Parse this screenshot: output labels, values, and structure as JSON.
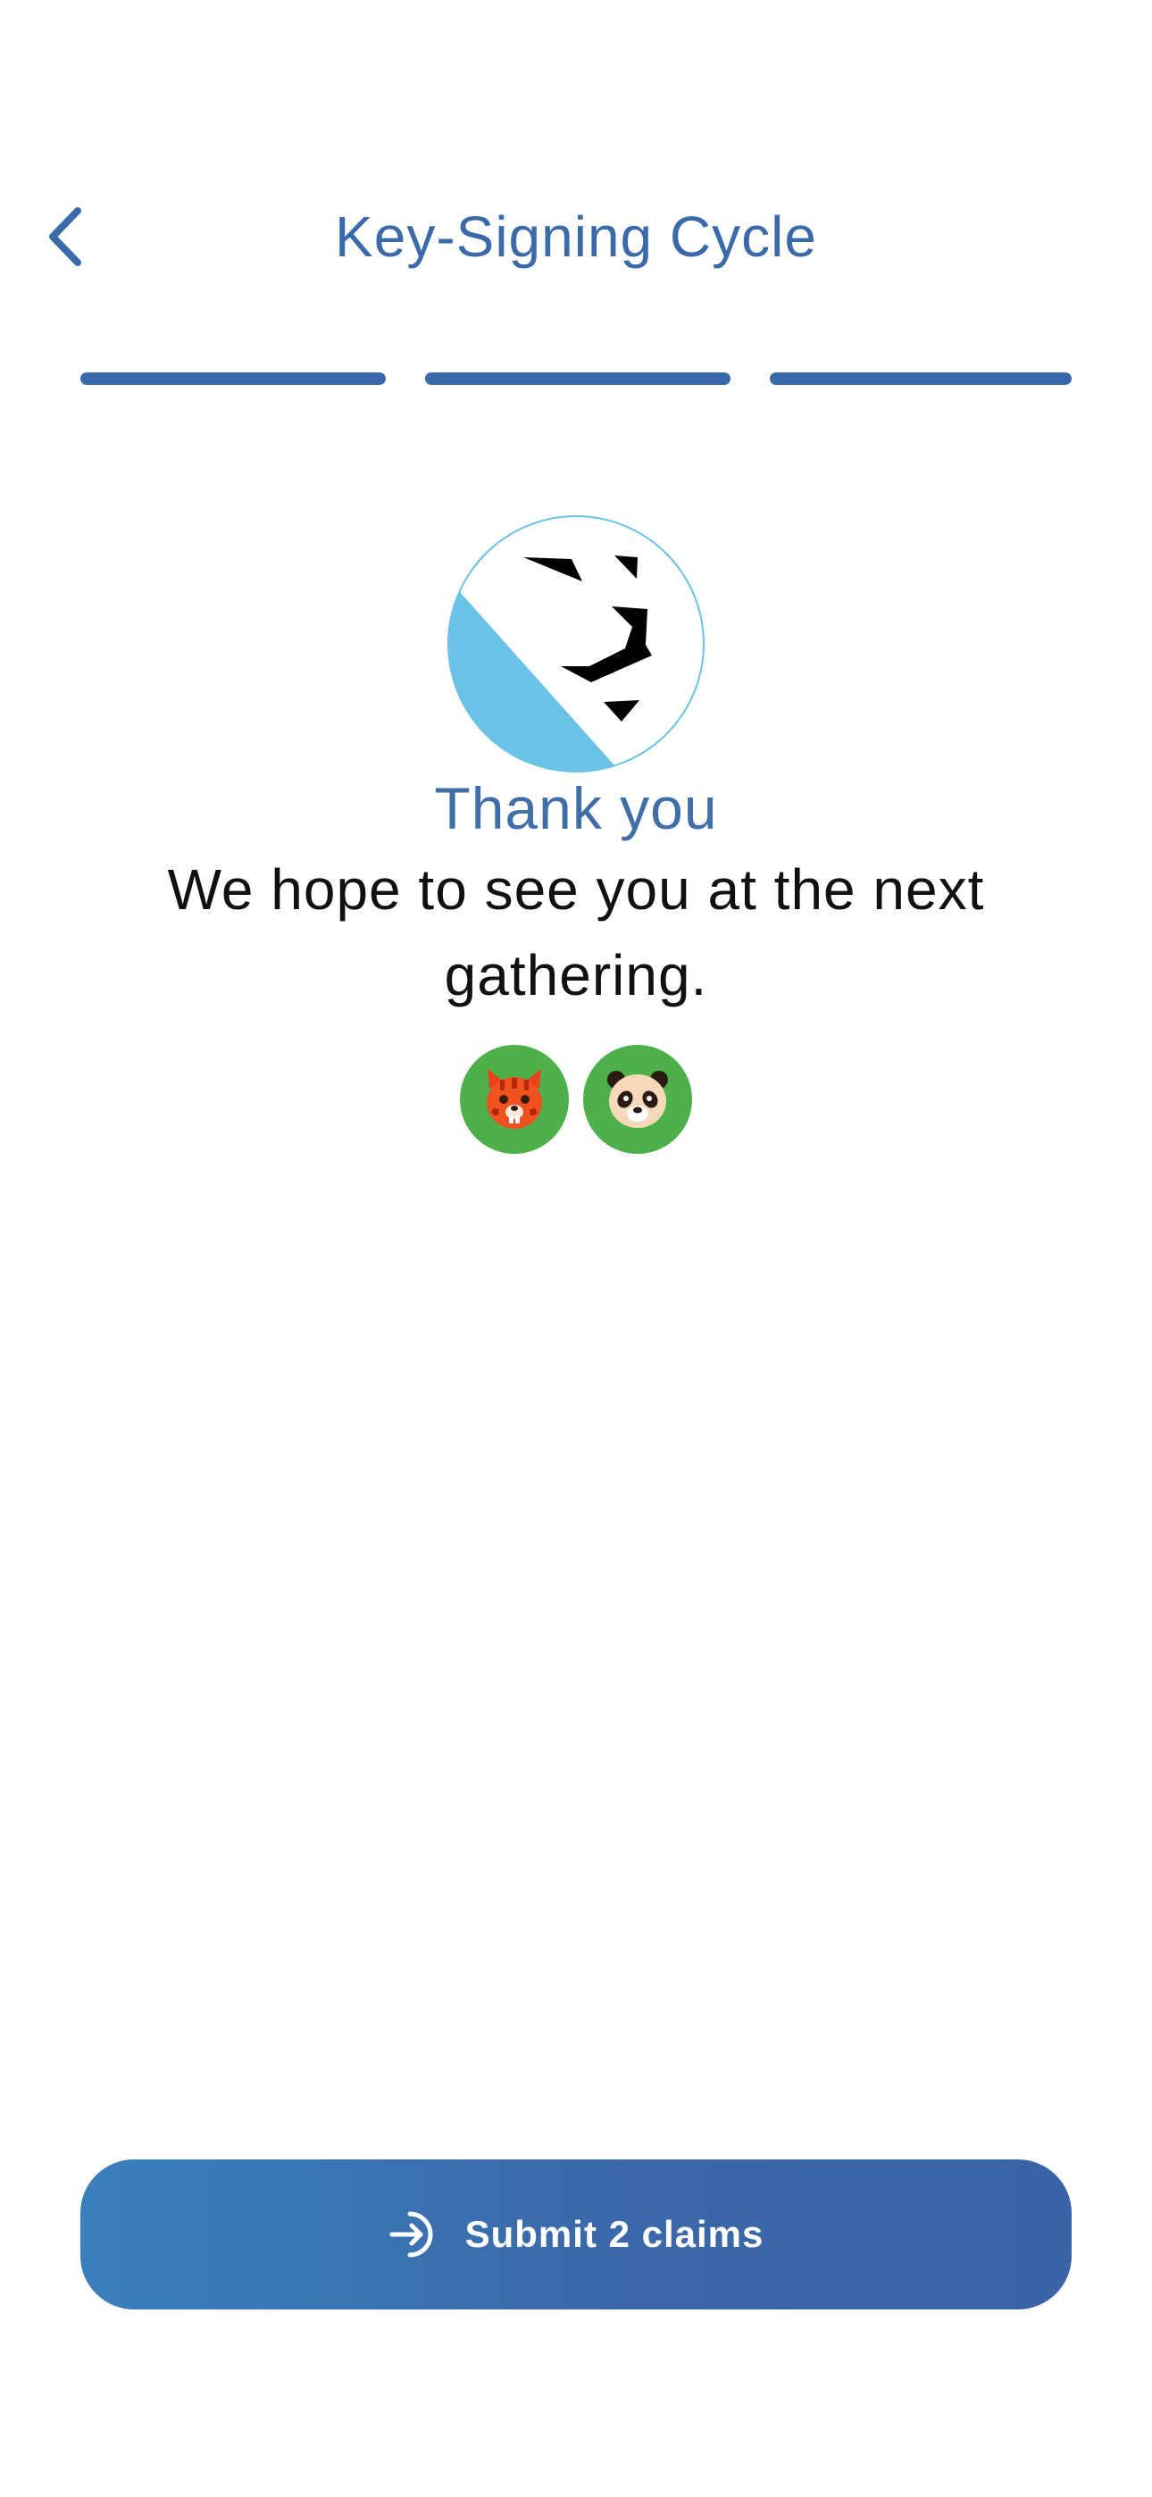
{
  "header": {
    "title": "Key-Signing Cycle",
    "back_icon": "chevron-left-icon"
  },
  "progress": {
    "total_steps": 3,
    "completed_steps": 3,
    "color": "#3a69a9"
  },
  "avatar": {
    "icon": "lion-icon",
    "accent_color": "#6ac3e6"
  },
  "content": {
    "title": "Thank you",
    "message": "We hope to see you at the next gathering."
  },
  "participants": [
    {
      "icon": "tiger-icon",
      "background": "#4db04a"
    },
    {
      "icon": "panda-icon",
      "background": "#4db04a"
    }
  ],
  "submit_button": {
    "label": "Submit 2 claims",
    "icon": "arrow-right-circle-icon"
  }
}
